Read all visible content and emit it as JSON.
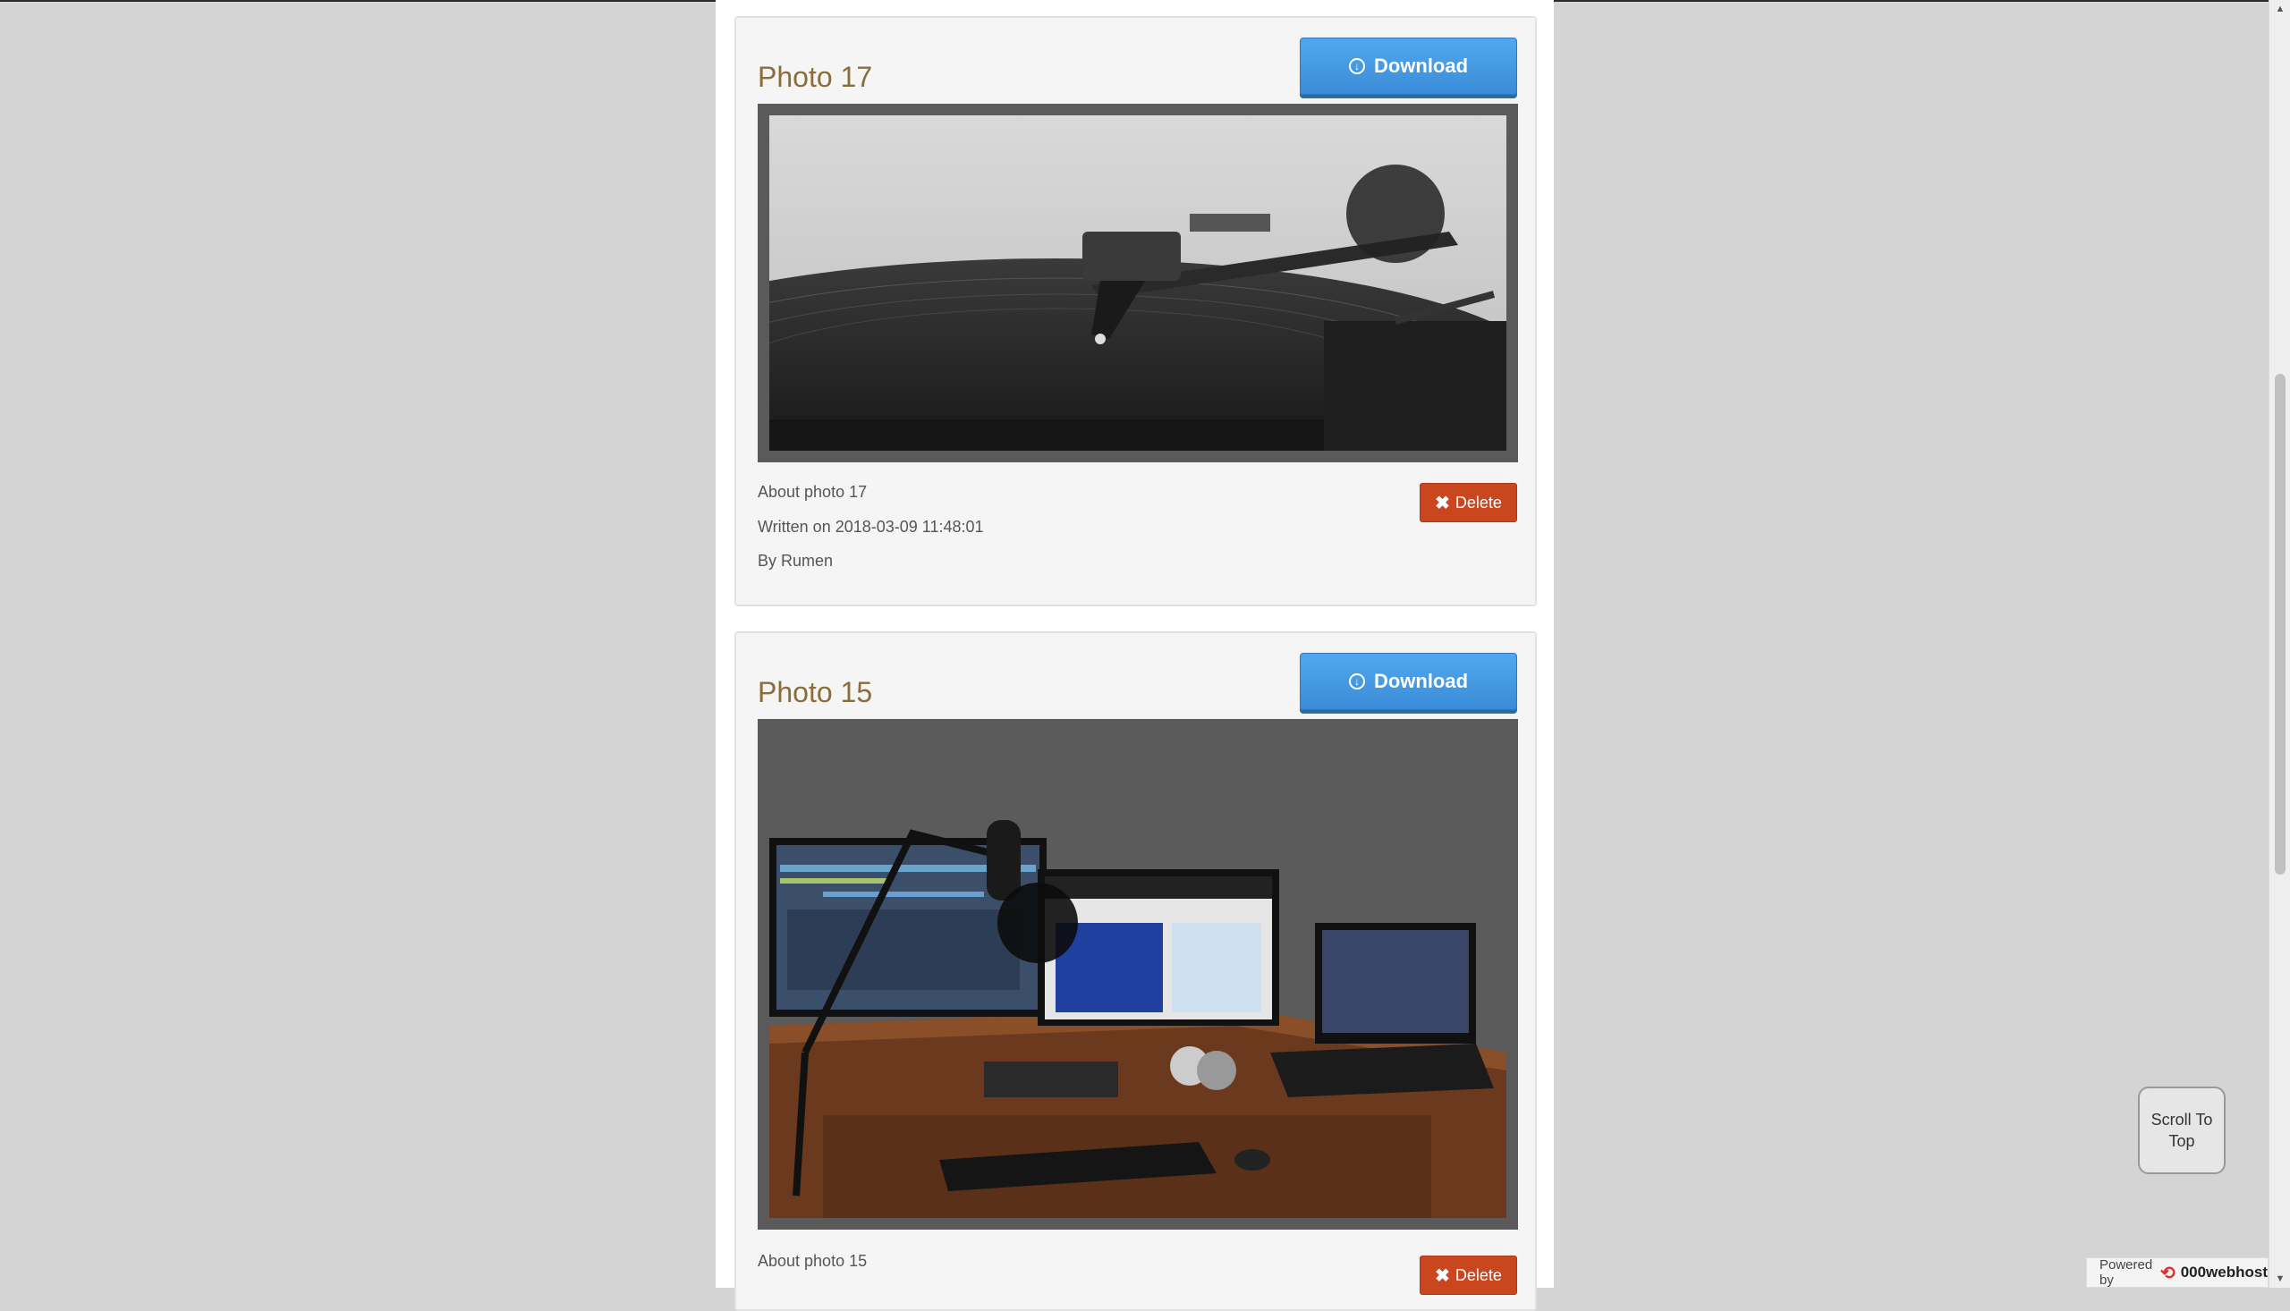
{
  "posts": [
    {
      "title": "Photo 17",
      "download_label": "Download",
      "photo_alt": "Turntable tonearm on vinyl record",
      "about": "About photo 17",
      "written": "Written on 2018-03-09 11:48:01",
      "author": "By Rumen",
      "delete_label": "Delete"
    },
    {
      "title": "Photo 15",
      "download_label": "Download",
      "photo_alt": "Home recording studio desk with monitors, microphone and laptop",
      "about": "About photo 15",
      "delete_label": "Delete"
    }
  ],
  "scroll_to_top": "Scroll To Top",
  "powered": {
    "prefix": "Powered by",
    "brand": "000webhost"
  },
  "colors": {
    "title": "#8a6d3b",
    "download": "#3a8cd8",
    "delete": "#c9461f",
    "background": "#d4d4d4"
  }
}
